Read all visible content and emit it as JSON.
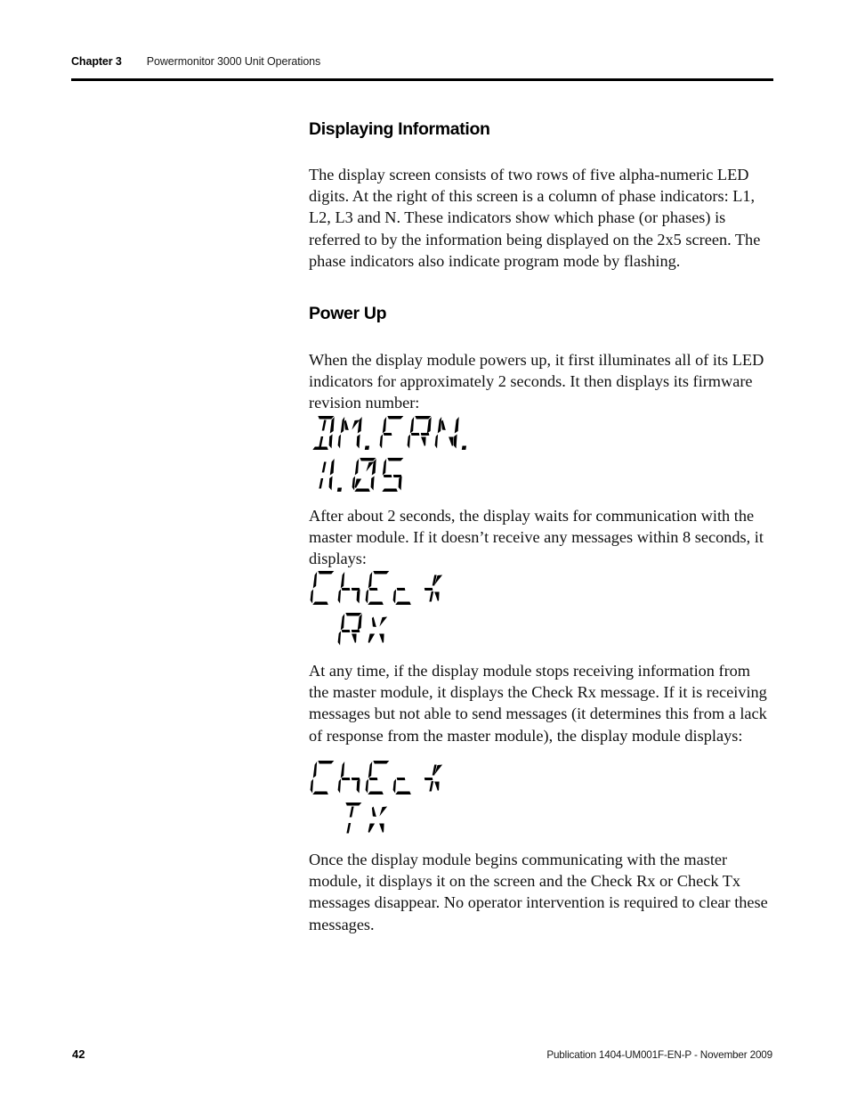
{
  "header": {
    "chapter_label": "Chapter 3",
    "chapter_title": "Powermonitor 3000 Unit Operations"
  },
  "sections": [
    {
      "heading": "Displaying Information",
      "paragraph": "The display screen consists of two rows of five alpha-numeric LED digits. At the right of this screen is a column of phase indicators: L1, L2, L3 and N. These indicators show which phase (or phases) is referred to by the information being displayed on the 2x5 screen. The phase indicators also indicate program mode by flashing."
    },
    {
      "heading": "Power Up",
      "paragraph": "When the display module powers up, it first illuminates all of its LED indicators for approximately 2 seconds. It then displays its firmware revision number:"
    }
  ],
  "paragraphs": {
    "after_firmware": "After about 2 seconds, the display waits for communication with the master module. If it doesn’t receive any messages within 8 seconds, it displays:",
    "after_check_rx": "At any time, if the display module stops receiving information from the master module, it displays the Check Rx message. If it is receiving messages but not able to send messages (it determines this from a lack of response from the master module), the display module displays:",
    "after_check_tx": "Once the display module begins communicating with the master module, it displays it on the screen and the Check Rx or Check Tx messages disappear. No operator intervention is required to clear these messages."
  },
  "led_displays": [
    {
      "name": "firmware-revision",
      "row1": "DM.FRN.",
      "row2": "1.05"
    },
    {
      "name": "check-rx",
      "row1": "Check",
      "row2": " Rx"
    },
    {
      "name": "check-tx",
      "row1": "Check",
      "row2": " Tx"
    }
  ],
  "footer": {
    "page_number": "42",
    "publication": "Publication 1404-UM001F-EN-P - November 2009"
  },
  "colors": {
    "text": "#111111",
    "rule": "#000000",
    "led": "#000000",
    "background": "#ffffff"
  }
}
